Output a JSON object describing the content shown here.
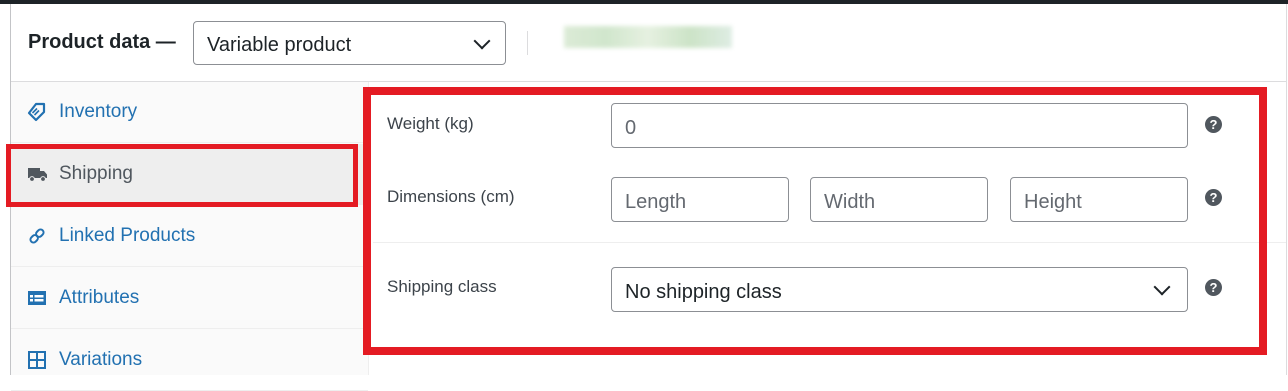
{
  "header": {
    "title": "Product data —",
    "product_type": {
      "selected": "Variable product"
    }
  },
  "sidebar": {
    "items": [
      {
        "label": "Inventory",
        "icon": "tag-icon",
        "active": false
      },
      {
        "label": "Shipping",
        "icon": "truck-icon",
        "active": true
      },
      {
        "label": "Linked Products",
        "icon": "link-icon",
        "active": false
      },
      {
        "label": "Attributes",
        "icon": "list-card-icon",
        "active": false
      },
      {
        "label": "Variations",
        "icon": "grid-icon",
        "active": false
      }
    ]
  },
  "shipping": {
    "weight": {
      "label": "Weight (kg)",
      "placeholder": "0",
      "value": ""
    },
    "dimensions": {
      "label": "Dimensions (cm)",
      "length_placeholder": "Length",
      "width_placeholder": "Width",
      "height_placeholder": "Height"
    },
    "shipping_class": {
      "label": "Shipping class",
      "selected": "No shipping class"
    },
    "help_glyph": "?"
  },
  "colors": {
    "highlight": "#e41b23",
    "link": "#2271b1",
    "icon": "#50575e"
  }
}
